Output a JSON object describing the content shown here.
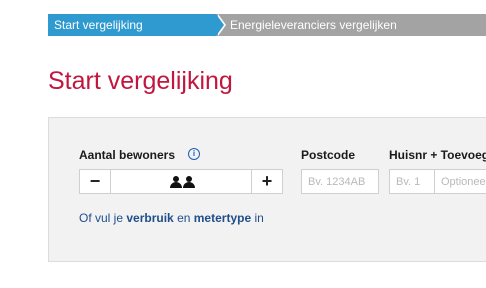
{
  "breadcrumb": {
    "active": "Start vergelijking",
    "next": "Energieleveranciers vergelijken"
  },
  "page": {
    "title": "Start vergelijking"
  },
  "form": {
    "residents": {
      "label": "Aantal bewoners",
      "info_icon": "info-circle-icon",
      "minus": "−",
      "plus": "+",
      "person_icons": [
        "person-icon",
        "person-icon"
      ]
    },
    "postcode": {
      "label": "Postcode",
      "placeholder": "Bv. 1234AB"
    },
    "house": {
      "label": "Huisnr + Toevoeging",
      "number_placeholder": "Bv. 1",
      "addition_placeholder": "Optioneel"
    },
    "hint": {
      "prefix": "Of vul je",
      "link1": "verbruik",
      "middle": "en",
      "link2": "metertype",
      "suffix": "in"
    }
  },
  "colors": {
    "accent_blue": "#2f9ad0",
    "title_red": "#c0163f",
    "link_blue": "#1f4e8c"
  }
}
